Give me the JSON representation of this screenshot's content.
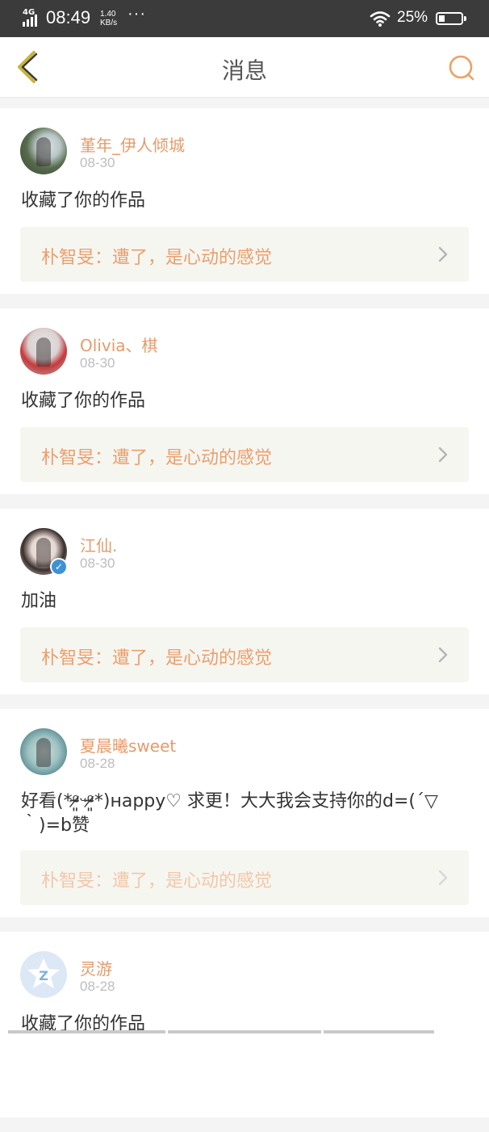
{
  "status_bar": {
    "network": "4G",
    "time": "08:49",
    "speed_value": "1.40",
    "speed_unit": "KB/s",
    "more": "···",
    "battery_percent": "25%",
    "battery_level": 0.25
  },
  "header": {
    "title": "消息",
    "back_icon": "chevron-left-icon",
    "search_icon": "search-icon",
    "accent_color": "#f0a060"
  },
  "messages": [
    {
      "username": "堇年_伊人倾城",
      "date": "08-30",
      "text": "收藏了你的作品",
      "work_title": "朴智旻：遭了，是心动的感觉",
      "verified": false
    },
    {
      "username": "Olivia、棋",
      "date": "08-30",
      "text": "收藏了你的作品",
      "work_title": "朴智旻：遭了，是心动的感觉",
      "verified": false
    },
    {
      "username": "江仙.",
      "date": "08-30",
      "text": "加油",
      "work_title": "朴智旻：遭了，是心动的感觉",
      "verified": true
    },
    {
      "username": "夏晨曦sweet",
      "date": "08-28",
      "text": "好看(*ᵒ̴̷͈ᵕᵒ̴̷͈*)ʜappy♡ 求更！大大我会支持你的d=(´▽｀)=b赞",
      "work_title": "朴智旻：遭了，是心动的感觉",
      "verified": false
    },
    {
      "username": "灵游",
      "date": "08-28",
      "text": "收藏了你的作品",
      "work_title": "",
      "verified": false
    }
  ],
  "colors": {
    "username": "#e59b6b",
    "work_title": "#eb9f6c",
    "verified_badge": "#3f92d2"
  }
}
